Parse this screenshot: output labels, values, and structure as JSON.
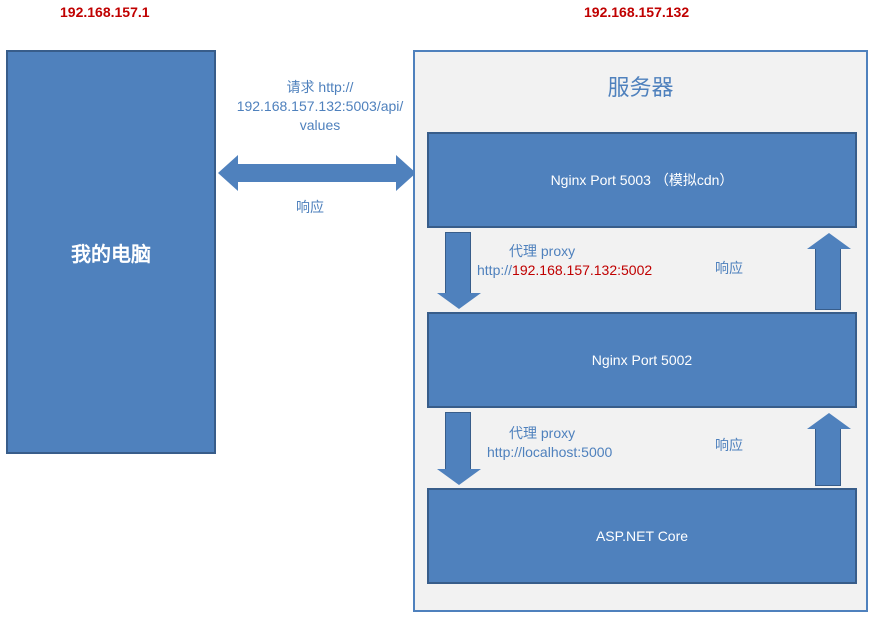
{
  "client_ip": "192.168.157.1",
  "server_ip": "192.168.157.132",
  "client_label": "我的电脑",
  "server_label": "服务器",
  "boxes": {
    "nginx_5003": "Nginx Port 5003 （模拟cdn）",
    "nginx_5002": "Nginx Port 5002",
    "aspnet": "ASP.NET Core"
  },
  "labels": {
    "request_line1": "请求 http://",
    "request_line2": "192.168.157.132:5003/api/",
    "request_line3": "values",
    "response": "响应",
    "proxy1_line1": "代理 proxy",
    "proxy1_prefix": "http://",
    "proxy1_red": "192.168.157.132:5002",
    "proxy1_response": "响应",
    "proxy2_line1": "代理 proxy",
    "proxy2_line2": "http://localhost:5000",
    "proxy2_response": "响应"
  }
}
